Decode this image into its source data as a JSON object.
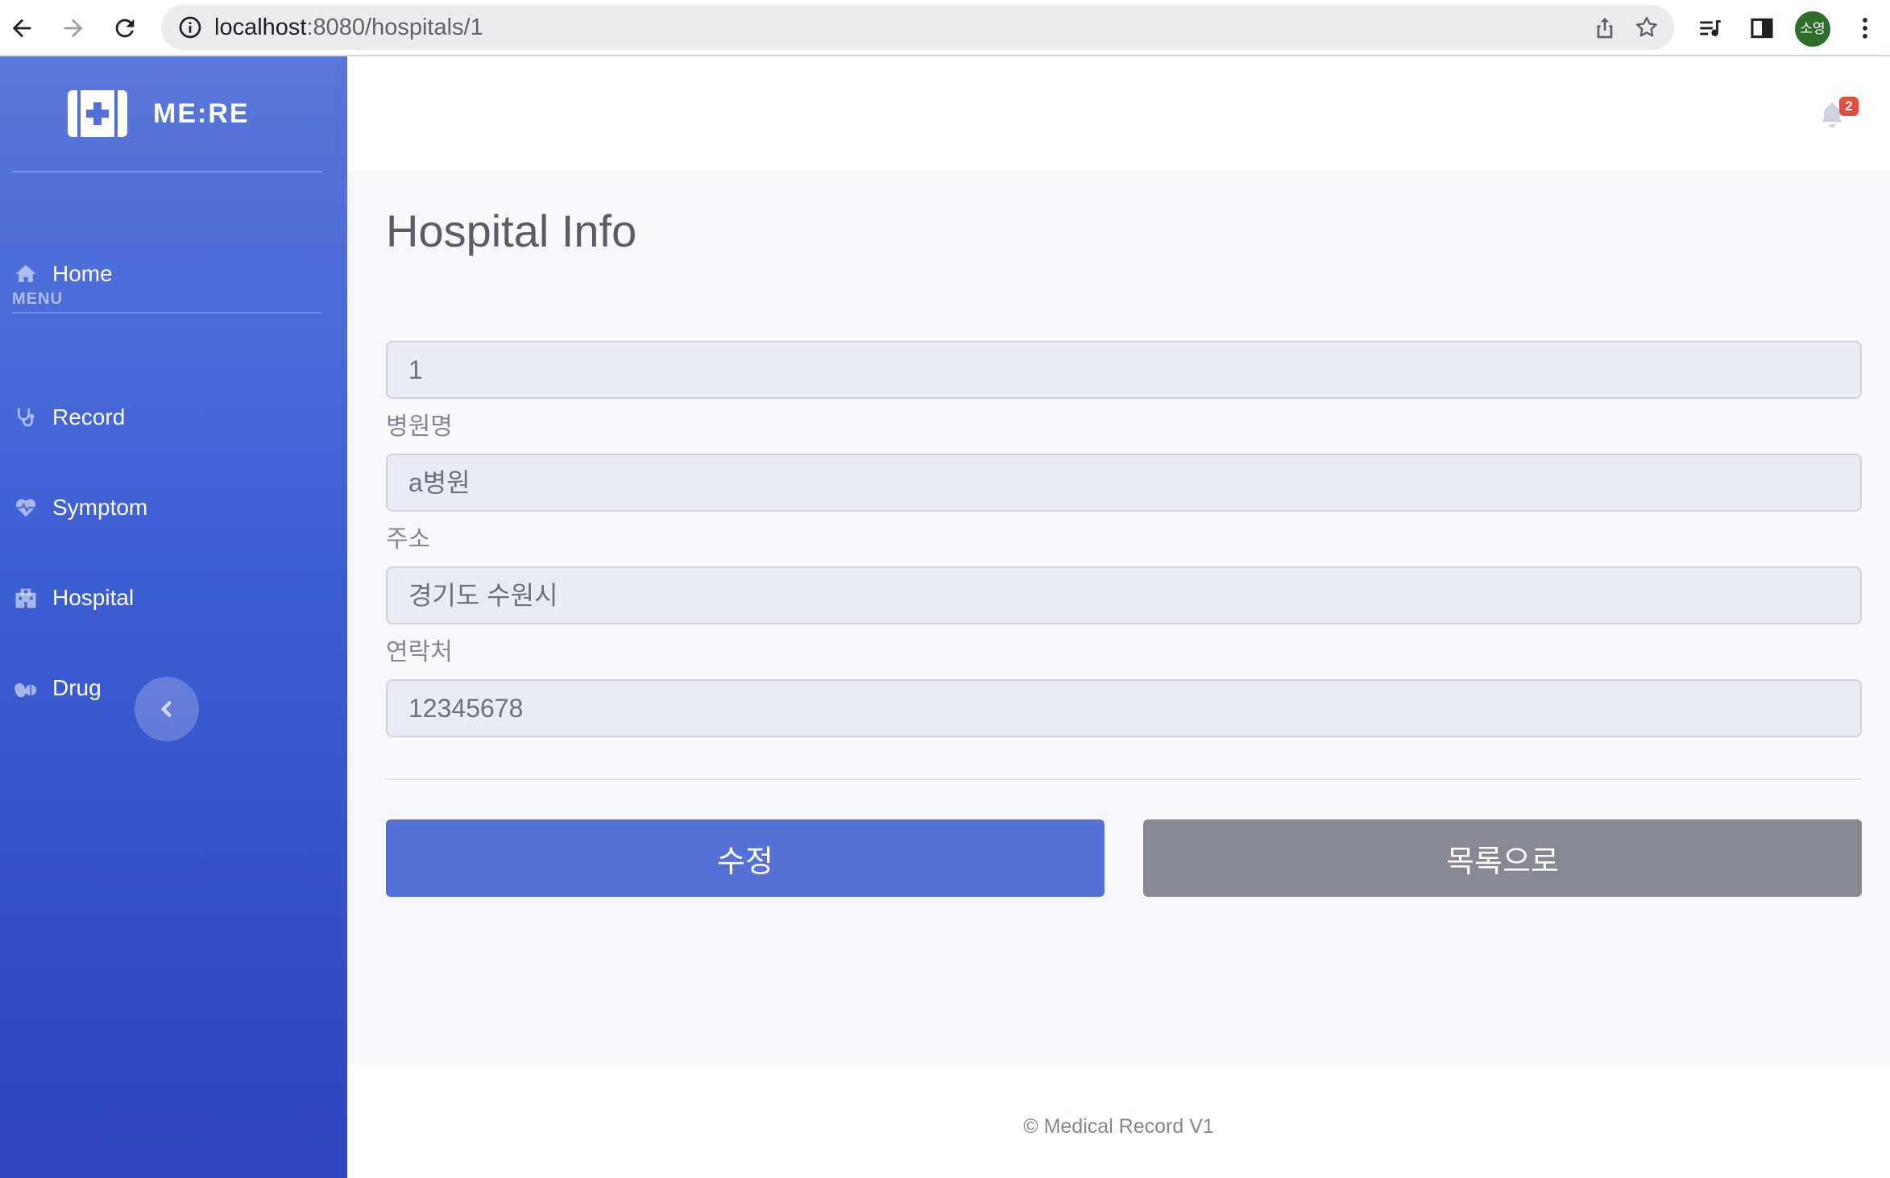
{
  "browser": {
    "url_host": "localhost",
    "url_path": ":8080/hospitals/1",
    "profile_initials": "소영"
  },
  "sidebar": {
    "brand": "ME:RE",
    "home_label": "Home",
    "menu_heading": "MENU",
    "items": [
      {
        "label": "Record",
        "icon": "stethoscope-icon"
      },
      {
        "label": "Symptom",
        "icon": "heartbeat-icon"
      },
      {
        "label": "Hospital",
        "icon": "hospital-icon"
      },
      {
        "label": "Drug",
        "icon": "pills-icon"
      }
    ]
  },
  "topbar": {
    "notification_count": "2"
  },
  "page": {
    "title": "Hospital Info",
    "fields": [
      {
        "label": "",
        "value": "1"
      },
      {
        "label": "병원명",
        "value": "a병원"
      },
      {
        "label": "주소",
        "value": "경기도 수원시"
      },
      {
        "label": "연락처",
        "value": "12345678"
      }
    ],
    "edit_button": "수정",
    "list_button": "목록으로"
  },
  "footer": {
    "copyright": "© Medical Record V1"
  },
  "colors": {
    "sidebar_top": "#5a78dc",
    "sidebar_bottom": "#2d46bd",
    "primary": "#5471d8",
    "secondary": "#868894",
    "badge": "#e74a3b"
  }
}
